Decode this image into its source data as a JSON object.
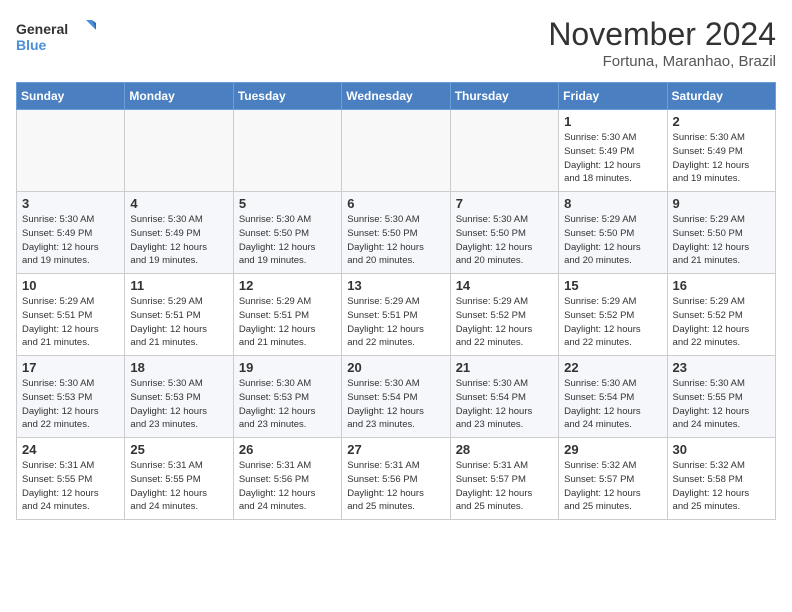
{
  "logo": {
    "name": "General",
    "name2": "Blue"
  },
  "header": {
    "month": "November 2024",
    "location": "Fortuna, Maranhao, Brazil"
  },
  "weekdays": [
    "Sunday",
    "Monday",
    "Tuesday",
    "Wednesday",
    "Thursday",
    "Friday",
    "Saturday"
  ],
  "weeks": [
    [
      {
        "day": "",
        "info": ""
      },
      {
        "day": "",
        "info": ""
      },
      {
        "day": "",
        "info": ""
      },
      {
        "day": "",
        "info": ""
      },
      {
        "day": "",
        "info": ""
      },
      {
        "day": "1",
        "info": "Sunrise: 5:30 AM\nSunset: 5:49 PM\nDaylight: 12 hours\nand 18 minutes."
      },
      {
        "day": "2",
        "info": "Sunrise: 5:30 AM\nSunset: 5:49 PM\nDaylight: 12 hours\nand 19 minutes."
      }
    ],
    [
      {
        "day": "3",
        "info": "Sunrise: 5:30 AM\nSunset: 5:49 PM\nDaylight: 12 hours\nand 19 minutes."
      },
      {
        "day": "4",
        "info": "Sunrise: 5:30 AM\nSunset: 5:49 PM\nDaylight: 12 hours\nand 19 minutes."
      },
      {
        "day": "5",
        "info": "Sunrise: 5:30 AM\nSunset: 5:50 PM\nDaylight: 12 hours\nand 19 minutes."
      },
      {
        "day": "6",
        "info": "Sunrise: 5:30 AM\nSunset: 5:50 PM\nDaylight: 12 hours\nand 20 minutes."
      },
      {
        "day": "7",
        "info": "Sunrise: 5:30 AM\nSunset: 5:50 PM\nDaylight: 12 hours\nand 20 minutes."
      },
      {
        "day": "8",
        "info": "Sunrise: 5:29 AM\nSunset: 5:50 PM\nDaylight: 12 hours\nand 20 minutes."
      },
      {
        "day": "9",
        "info": "Sunrise: 5:29 AM\nSunset: 5:50 PM\nDaylight: 12 hours\nand 21 minutes."
      }
    ],
    [
      {
        "day": "10",
        "info": "Sunrise: 5:29 AM\nSunset: 5:51 PM\nDaylight: 12 hours\nand 21 minutes."
      },
      {
        "day": "11",
        "info": "Sunrise: 5:29 AM\nSunset: 5:51 PM\nDaylight: 12 hours\nand 21 minutes."
      },
      {
        "day": "12",
        "info": "Sunrise: 5:29 AM\nSunset: 5:51 PM\nDaylight: 12 hours\nand 21 minutes."
      },
      {
        "day": "13",
        "info": "Sunrise: 5:29 AM\nSunset: 5:51 PM\nDaylight: 12 hours\nand 22 minutes."
      },
      {
        "day": "14",
        "info": "Sunrise: 5:29 AM\nSunset: 5:52 PM\nDaylight: 12 hours\nand 22 minutes."
      },
      {
        "day": "15",
        "info": "Sunrise: 5:29 AM\nSunset: 5:52 PM\nDaylight: 12 hours\nand 22 minutes."
      },
      {
        "day": "16",
        "info": "Sunrise: 5:29 AM\nSunset: 5:52 PM\nDaylight: 12 hours\nand 22 minutes."
      }
    ],
    [
      {
        "day": "17",
        "info": "Sunrise: 5:30 AM\nSunset: 5:53 PM\nDaylight: 12 hours\nand 22 minutes."
      },
      {
        "day": "18",
        "info": "Sunrise: 5:30 AM\nSunset: 5:53 PM\nDaylight: 12 hours\nand 23 minutes."
      },
      {
        "day": "19",
        "info": "Sunrise: 5:30 AM\nSunset: 5:53 PM\nDaylight: 12 hours\nand 23 minutes."
      },
      {
        "day": "20",
        "info": "Sunrise: 5:30 AM\nSunset: 5:54 PM\nDaylight: 12 hours\nand 23 minutes."
      },
      {
        "day": "21",
        "info": "Sunrise: 5:30 AM\nSunset: 5:54 PM\nDaylight: 12 hours\nand 23 minutes."
      },
      {
        "day": "22",
        "info": "Sunrise: 5:30 AM\nSunset: 5:54 PM\nDaylight: 12 hours\nand 24 minutes."
      },
      {
        "day": "23",
        "info": "Sunrise: 5:30 AM\nSunset: 5:55 PM\nDaylight: 12 hours\nand 24 minutes."
      }
    ],
    [
      {
        "day": "24",
        "info": "Sunrise: 5:31 AM\nSunset: 5:55 PM\nDaylight: 12 hours\nand 24 minutes."
      },
      {
        "day": "25",
        "info": "Sunrise: 5:31 AM\nSunset: 5:55 PM\nDaylight: 12 hours\nand 24 minutes."
      },
      {
        "day": "26",
        "info": "Sunrise: 5:31 AM\nSunset: 5:56 PM\nDaylight: 12 hours\nand 24 minutes."
      },
      {
        "day": "27",
        "info": "Sunrise: 5:31 AM\nSunset: 5:56 PM\nDaylight: 12 hours\nand 25 minutes."
      },
      {
        "day": "28",
        "info": "Sunrise: 5:31 AM\nSunset: 5:57 PM\nDaylight: 12 hours\nand 25 minutes."
      },
      {
        "day": "29",
        "info": "Sunrise: 5:32 AM\nSunset: 5:57 PM\nDaylight: 12 hours\nand 25 minutes."
      },
      {
        "day": "30",
        "info": "Sunrise: 5:32 AM\nSunset: 5:58 PM\nDaylight: 12 hours\nand 25 minutes."
      }
    ]
  ]
}
